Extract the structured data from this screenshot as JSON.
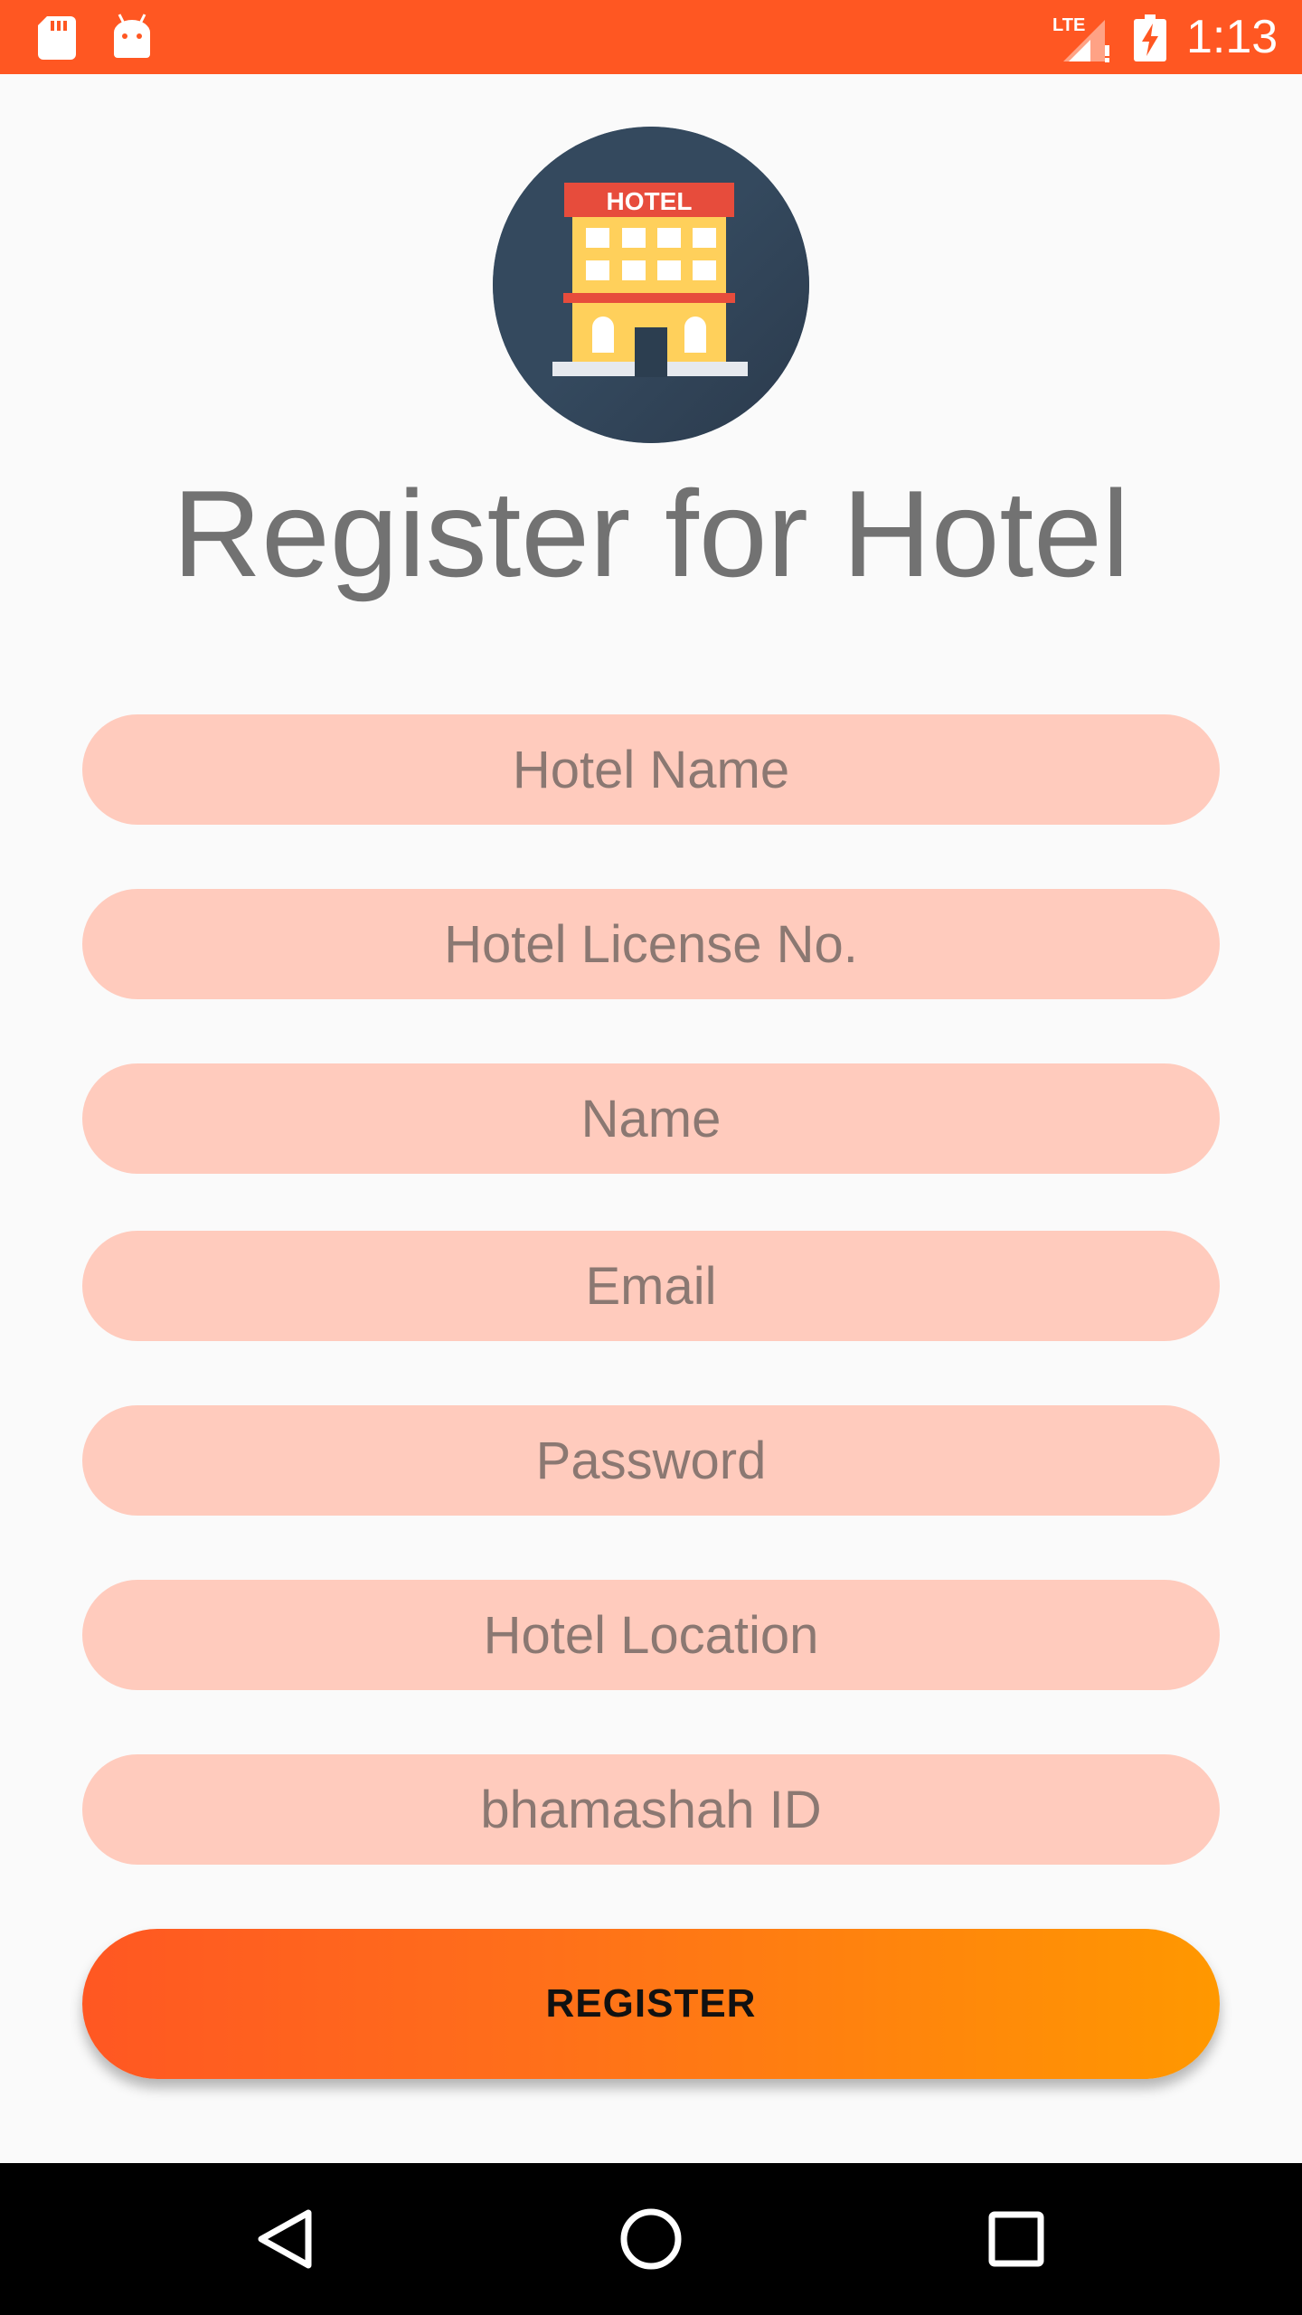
{
  "status_bar": {
    "time": "1:13",
    "network": "LTE",
    "icons": [
      "sd-card-icon",
      "android-icon",
      "lte-signal-icon",
      "battery-charging-icon"
    ]
  },
  "logo": {
    "sign_text": "HOTEL",
    "icon": "hotel-building-icon"
  },
  "page": {
    "title": "Register for Hotel"
  },
  "form": {
    "fields": [
      {
        "placeholder": "Hotel Name",
        "value": ""
      },
      {
        "placeholder": "Hotel License No.",
        "value": ""
      },
      {
        "placeholder": "Name",
        "value": ""
      },
      {
        "placeholder": "Email",
        "value": ""
      },
      {
        "placeholder": "Password",
        "value": ""
      },
      {
        "placeholder": "Hotel Location",
        "value": ""
      },
      {
        "placeholder": "bhamashah ID",
        "value": ""
      }
    ],
    "submit_label": "REGISTER"
  },
  "navigation": {
    "buttons": [
      "back-icon",
      "home-icon",
      "recents-icon"
    ]
  },
  "colors": {
    "accent": "#ff5722",
    "accent_end": "#ff9800",
    "field_bg": "#ffcbbd",
    "logo_bg": "#34495e"
  }
}
